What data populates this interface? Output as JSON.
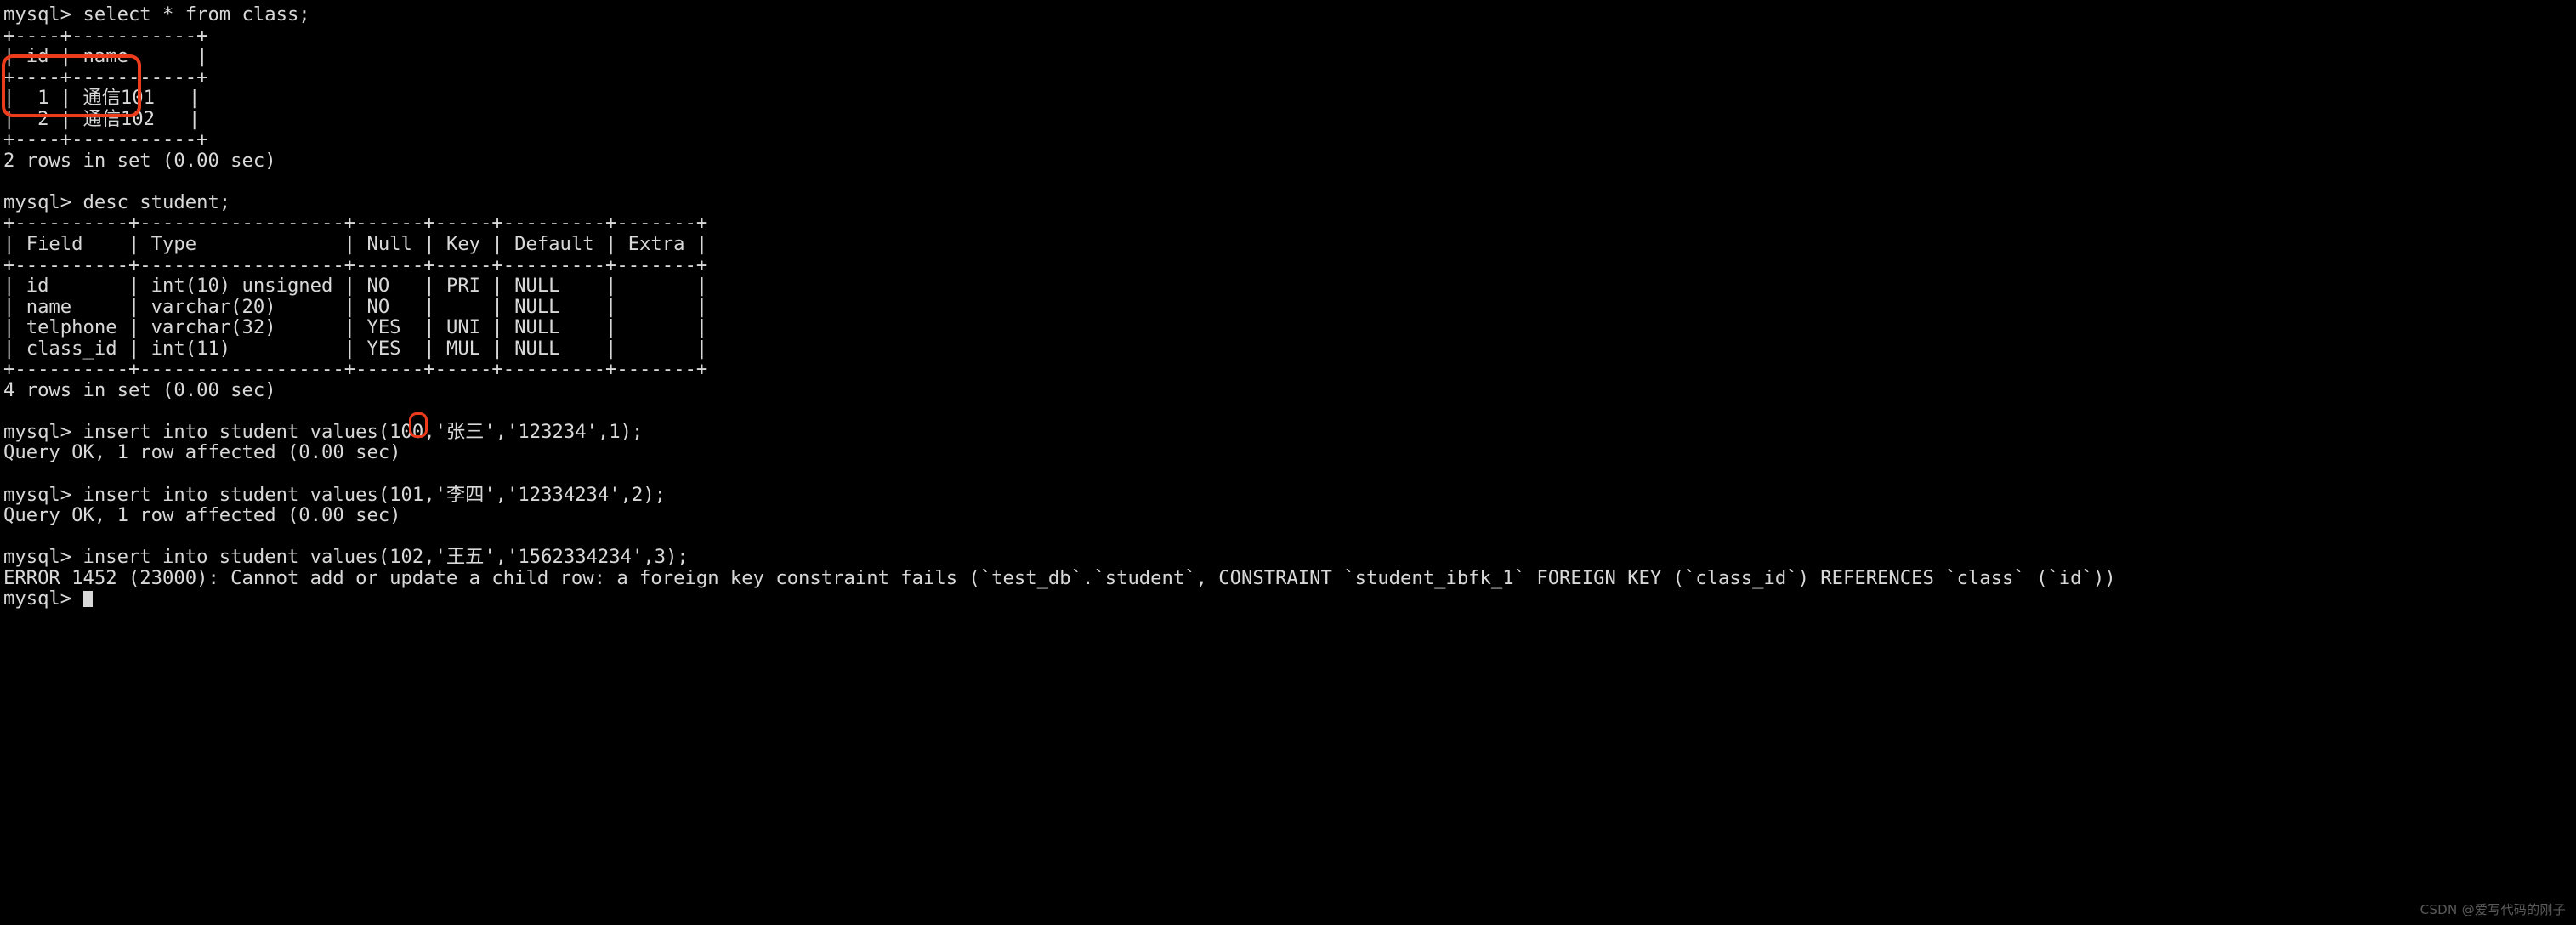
{
  "terminal": {
    "prompt": "mysql> ",
    "colors": {
      "background": "#000000",
      "foreground": "#d8d8d8",
      "annotation": "#ec3c1b",
      "watermark": "#5a5a5a"
    },
    "lines": [
      "mysql> select * from class;",
      "+----+-----------+",
      "| id | name      |",
      "+----+-----------+",
      "|  1 | 通信101   |",
      "|  2 | 通信102   |",
      "+----+-----------+",
      "2 rows in set (0.00 sec)",
      "",
      "mysql> desc student;",
      "+----------+------------------+------+-----+---------+-------+",
      "| Field    | Type             | Null | Key | Default | Extra |",
      "+----------+------------------+------+-----+---------+-------+",
      "| id       | int(10) unsigned | NO   | PRI | NULL    |       |",
      "| name     | varchar(20)      | NO   |     | NULL    |       |",
      "| telphone | varchar(32)      | YES  | UNI | NULL    |       |",
      "| class_id | int(11)          | YES  | MUL | NULL    |       |",
      "+----------+------------------+------+-----+---------+-------+",
      "4 rows in set (0.00 sec)",
      "",
      "mysql> insert into student values(100,'张三','123234',1);",
      "Query OK, 1 row affected (0.00 sec)",
      "",
      "mysql> insert into student values(101,'李四','12334234',2);",
      "Query OK, 1 row affected (0.00 sec)",
      "",
      "mysql> insert into student values(102,'王五','1562334234',3);",
      "ERROR 1452 (23000): Cannot add or update a child row: a foreign key constraint fails (`test_db`.`student`, CONSTRAINT `student_ibfk_1` FOREIGN KEY (`class_id`) REFERENCES `class` (`id`))"
    ],
    "final_prompt": "mysql> "
  },
  "annotations": {
    "class_rows_box_label": "highlight around class table data rows",
    "class_id_value_label": "highlight around class_id value 3"
  },
  "watermark": {
    "text": "CSDN @爱写代码的刚子"
  }
}
